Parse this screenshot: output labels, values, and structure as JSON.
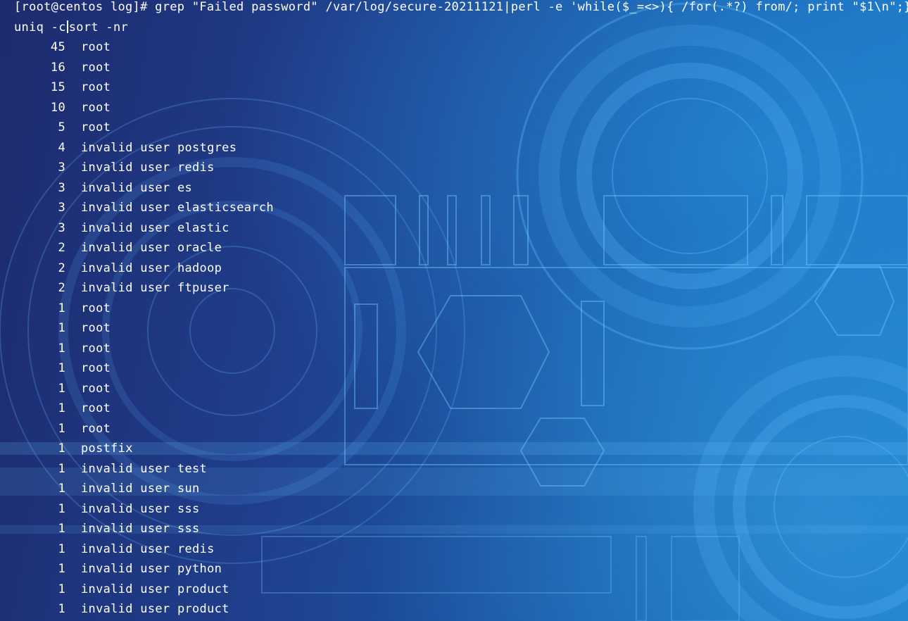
{
  "command": {
    "line1": "[root@centos log]# grep \"Failed password\" /var/log/secure-20211121|perl -e 'while($_=<>){ /for(.*?) from/; print \"$1\\n\";}",
    "line2_a": "uniq -c",
    "line2_b": "sort -nr"
  },
  "rows": [
    {
      "count": "45",
      "user": "root"
    },
    {
      "count": "16",
      "user": "root"
    },
    {
      "count": "15",
      "user": "root"
    },
    {
      "count": "10",
      "user": "root"
    },
    {
      "count": "5",
      "user": "root"
    },
    {
      "count": "4",
      "user": "invalid user postgres"
    },
    {
      "count": "3",
      "user": "invalid user redis"
    },
    {
      "count": "3",
      "user": "invalid user es"
    },
    {
      "count": "3",
      "user": "invalid user elasticsearch"
    },
    {
      "count": "3",
      "user": "invalid user elastic"
    },
    {
      "count": "2",
      "user": "invalid user oracle"
    },
    {
      "count": "2",
      "user": "invalid user hadoop"
    },
    {
      "count": "2",
      "user": "invalid user ftpuser"
    },
    {
      "count": "1",
      "user": "root"
    },
    {
      "count": "1",
      "user": "root"
    },
    {
      "count": "1",
      "user": "root"
    },
    {
      "count": "1",
      "user": "root"
    },
    {
      "count": "1",
      "user": "root"
    },
    {
      "count": "1",
      "user": "root"
    },
    {
      "count": "1",
      "user": "root"
    },
    {
      "count": "1",
      "user": "postfix"
    },
    {
      "count": "1",
      "user": "invalid user test"
    },
    {
      "count": "1",
      "user": "invalid user sun"
    },
    {
      "count": "1",
      "user": "invalid user sss"
    },
    {
      "count": "1",
      "user": "invalid user sss"
    },
    {
      "count": "1",
      "user": "invalid user redis"
    },
    {
      "count": "1",
      "user": "invalid user python"
    },
    {
      "count": "1",
      "user": "invalid user product"
    },
    {
      "count": "1",
      "user": "invalid user product"
    }
  ],
  "colors": {
    "text": "#ffffff",
    "background": "#1f4fa0",
    "decoration": "#5fb8ff"
  }
}
